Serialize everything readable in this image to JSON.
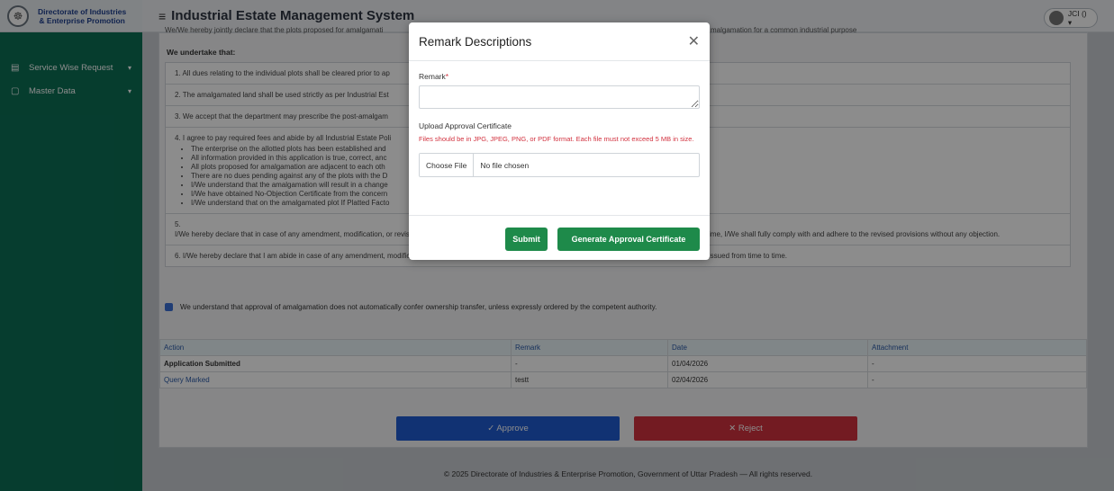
{
  "brand": {
    "line1": "Directorate of Industries",
    "line2": "& Enterprise Promotion"
  },
  "app_title": "Industrial Estate Management System",
  "user_label": "JCI () ▾",
  "sidebar": {
    "items": [
      {
        "label": "Service Wise Request",
        "icon": "list-icon"
      },
      {
        "label": "Master Data",
        "icon": "doc-icon"
      }
    ]
  },
  "declaration_top_left": "We/We hereby jointly declare that the plots proposed for amalgamati",
  "declaration_top_right": "malgamation for a common industrial purpose",
  "undertake_heading": "We undertake that:",
  "terms": [
    "1. All dues relating to the individual plots shall be cleared prior to ap",
    "2. The amalgamated land shall be used strictly as per Industrial Est",
    "3. We accept that the department may prescribe the post-amalgam",
    "4. I agree to pay required fees and abide by all Industrial Estate Poli",
    "5.",
    "6. I/We hereby declare that I am abide in case of any amendment, modification, or revision in the Industrial Estate Management Policy / SOP or any Government Order issued from time to time."
  ],
  "term4_bullets": [
    "The enterprise on the allotted plots has been established and",
    "All information provided in this application is true, correct, anc",
    "All plots proposed for amalgamation are adjacent to each oth",
    "There are no dues pending against any of the plots with the D",
    "I/We understand that the amalgamation will result in a change",
    "I/We have obtained No-Objection Certificate from the concern",
    "I/We understand that on the amalgamated plot If Platted Facto"
  ],
  "term5_text": "I/We hereby declare that in case of any amendment, modification, or revision in the Industrial Estate Management Policy or any Government Order issued from time to time, I/We shall fully comply with and adhere to the revised provisions without any objection.",
  "acknowledgement": "We understand that approval of amalgamation does not automatically confer ownership transfer, unless expressly ordered by the competent authority.",
  "history": {
    "headers": [
      "Action",
      "Remark",
      "Date",
      "Attachment"
    ],
    "rows": [
      {
        "action": "Application Submitted",
        "remark": "-",
        "date": "01/04/2026",
        "attachment": "-"
      },
      {
        "action": "Query Marked",
        "remark": "testt",
        "date": "02/04/2026",
        "attachment": "-"
      }
    ]
  },
  "approve_label": "✓ Approve",
  "reject_label": "✕ Reject",
  "footer": "© 2025 Directorate of Industries & Enterprise Promotion, Government of Uttar Pradesh — All rights reserved.",
  "modal": {
    "title": "Remark Descriptions",
    "remark_label": "Remark",
    "remark_required_mark": "*",
    "remark_value": "",
    "upload_label": "Upload Approval Certificate",
    "upload_hint": "Files should be in JPG, JPEG, PNG, or PDF format. Each file must not exceed 5 MB in size.",
    "choose_file_label": "Choose File",
    "no_file_text": "No file chosen",
    "submit_label": "Submit",
    "generate_label": "Generate Approval Certificate"
  },
  "colors": {
    "sidebar": "#0b6f55",
    "approve": "#1f5bd1",
    "reject": "#d2323f",
    "modal_buttons": "#1e8a4a"
  }
}
